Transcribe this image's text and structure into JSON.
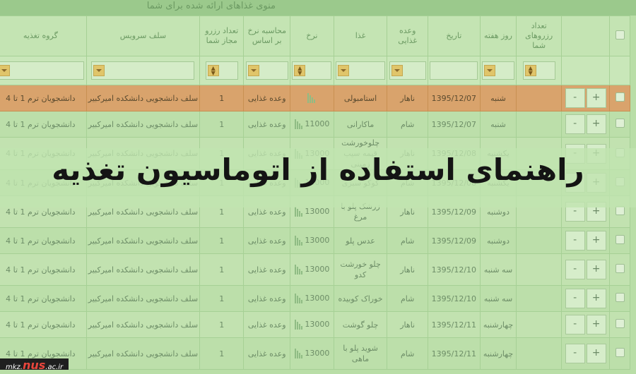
{
  "table_caption": "منوی غذاهای ارائه شده برای شما",
  "columns": [
    "",
    "",
    "تعداد رزروهای شما",
    "روز هفته",
    "تاریخ",
    "وعده غذایی",
    "غذا",
    "نرخ",
    "محاسبه نرخ بر اساس",
    "تعداد رزرو مجاز شما",
    "سلف سرویس",
    "گروه تغذیه"
  ],
  "rows": [
    {
      "day": "شنبه",
      "date": "1395/12/07",
      "meal": "ناهار",
      "food": "استامبولی",
      "price": "",
      "basis": "وعده غذایی",
      "allowed": "1",
      "self": "سلف دانشجویی دانشکده امیرکبیر",
      "group": "دانشجویان ترم 1 تا 4"
    },
    {
      "day": "شنبه",
      "date": "1395/12/07",
      "meal": "شام",
      "food": "ماکارانی",
      "price": "11000",
      "basis": "وعده غذایی",
      "allowed": "1",
      "self": "سلف دانشجویی دانشکده امیرکبیر",
      "group": "دانشجویان ترم 1 تا 4"
    },
    {
      "day": "یکشنبه",
      "date": "1395/12/08",
      "meal": "ناهار",
      "food": "چلوخورشت قیمه سیب زمینی",
      "price": "13000",
      "basis": "وعده غذایی",
      "allowed": "1",
      "self": "سلف دانشجویی دانشکده امیرکبیر",
      "group": "دانشجویان ترم 1 تا 4"
    },
    {
      "day": "یکشنبه",
      "date": "1395/12/08",
      "meal": "شام",
      "food": "کوکو سبزی",
      "price": "11000",
      "basis": "وعده غذایی",
      "allowed": "1",
      "self": "سلف دانشجویی دانشکده امیرکبیر",
      "group": "دانشجویان ترم 1 تا 4"
    },
    {
      "day": "دوشنبه",
      "date": "1395/12/09",
      "meal": "ناهار",
      "food": "زرشک پلو با مرغ",
      "price": "13000",
      "basis": "وعده غذایی",
      "allowed": "1",
      "self": "سلف دانشجویی دانشکده امیرکبیر",
      "group": "دانشجویان ترم 1 تا 4"
    },
    {
      "day": "دوشنبه",
      "date": "1395/12/09",
      "meal": "شام",
      "food": "عدس پلو",
      "price": "13000",
      "basis": "وعده غذایی",
      "allowed": "1",
      "self": "سلف دانشجویی دانشکده امیرکبیر",
      "group": "دانشجویان ترم 1 تا 4"
    },
    {
      "day": "سه شنبه",
      "date": "1395/12/10",
      "meal": "ناهار",
      "food": "چلو خورشت کدو",
      "price": "13000",
      "basis": "وعده غذایی",
      "allowed": "1",
      "self": "سلف دانشجویی دانشکده امیرکبیر",
      "group": "دانشجویان ترم 1 تا 4"
    },
    {
      "day": "سه شنبه",
      "date": "1395/12/10",
      "meal": "شام",
      "food": "خوراک کوبیده",
      "price": "13000",
      "basis": "وعده غذایی",
      "allowed": "1",
      "self": "سلف دانشجویی دانشکده امیرکبیر",
      "group": "دانشجویان ترم 1 تا 4"
    },
    {
      "day": "چهارشنبه",
      "date": "1395/12/11",
      "meal": "ناهار",
      "food": "چلو گوشت",
      "price": "13000",
      "basis": "وعده غذایی",
      "allowed": "1",
      "self": "سلف دانشجویی دانشکده امیرکبیر",
      "group": "دانشجویان ترم 1 تا 4"
    },
    {
      "day": "چهارشنبه",
      "date": "1395/12/11",
      "meal": "شام",
      "food": "شوید پلو با ماهی",
      "price": "13000",
      "basis": "وعده غذایی",
      "allowed": "1",
      "self": "سلف دانشجویی دانشکده امیرکبیر",
      "group": "دانشجویان ترم 1 تا 4"
    }
  ],
  "plus_label": "+",
  "minus_label": "-",
  "banner_title": "راهنمای استفاده از اتوماسیون تغذیه",
  "footer": {
    "prefix": "mkz.",
    "brand": "nus",
    "suffix": ".ac.ir"
  },
  "colors": {
    "selected_row": "#d9a36c",
    "overlay": "#b9dea7",
    "title": "#141414"
  }
}
